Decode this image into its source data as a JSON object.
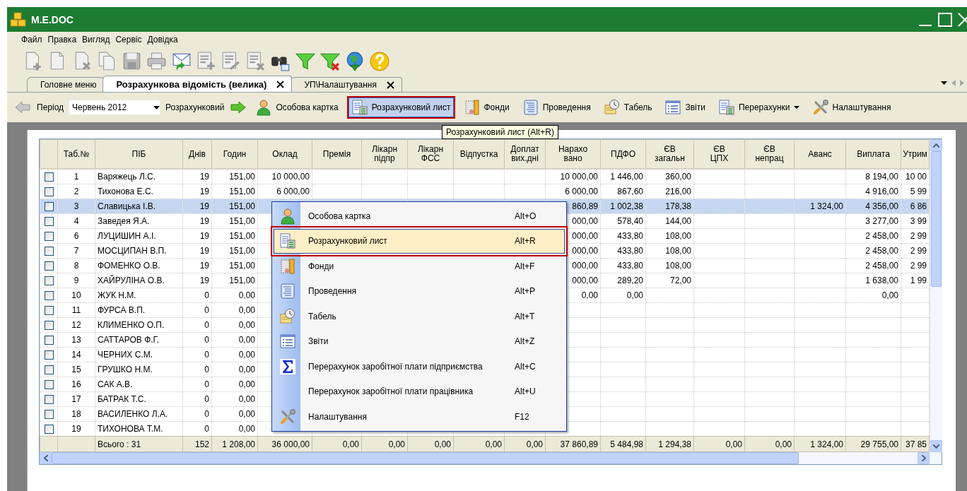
{
  "window": {
    "title": "M.E.DOC"
  },
  "menu_bar": [
    "Файл",
    "Правка",
    "Вигляд",
    "Сервіс",
    "Довідка"
  ],
  "tabs": [
    {
      "label": "Головне меню",
      "selected": false,
      "closable": false
    },
    {
      "label": "Розрахункова відомість (велика)",
      "selected": true,
      "closable": true
    },
    {
      "label": "УП\\Налаштування",
      "selected": false,
      "closable": true
    }
  ],
  "doc_toolbar": {
    "period_label": "Період",
    "period_value": "Червень 2012",
    "mode_label": "Розрахунковий",
    "buttons": [
      {
        "label": "Особова картка",
        "selected": false,
        "annotated": false,
        "dropdown": false
      },
      {
        "label": "Розрахунковий лист",
        "selected": true,
        "annotated": true,
        "dropdown": false
      },
      {
        "label": "Фонди",
        "selected": false,
        "annotated": false,
        "dropdown": false
      },
      {
        "label": "Проведення",
        "selected": false,
        "annotated": false,
        "dropdown": false
      },
      {
        "label": "Табель",
        "selected": false,
        "annotated": false,
        "dropdown": false
      },
      {
        "label": "Звіти",
        "selected": false,
        "annotated": false,
        "dropdown": false
      },
      {
        "label": "Перерахунки",
        "selected": false,
        "annotated": false,
        "dropdown": true
      },
      {
        "label": "Налаштування",
        "selected": false,
        "annotated": false,
        "dropdown": false
      }
    ]
  },
  "tooltip": "Розрахунковий лист (Alt+R)",
  "table": {
    "columns": [
      "Таб.№",
      "ПІБ",
      "Днів",
      "Годин",
      "Оклад",
      "Премія",
      "Лікарн\nпідпр",
      "Лікарн\nФСС",
      "Відпустка",
      "Доплат\nвих.дні",
      "Нарахо\nвано",
      "ПДФО",
      "ЄВ\nзагальн",
      "ЄВ\nЦПХ",
      "ЄВ\nнепрац",
      "Аванс",
      "Виплата",
      "Утрим"
    ],
    "rows": [
      {
        "checked": false,
        "selected": false,
        "cells": [
          "1",
          "Варяжець Л.С.",
          "19",
          "151,00",
          "10 000,00",
          null,
          null,
          null,
          null,
          null,
          "10 000,00",
          "1 446,00",
          "360,00",
          null,
          null,
          null,
          "8 194,00",
          "10 00"
        ]
      },
      {
        "checked": false,
        "selected": false,
        "cells": [
          "2",
          "Тихонова Е.С.",
          "19",
          "151,00",
          "6 000,00",
          null,
          null,
          null,
          null,
          null,
          "6 000,00",
          "867,60",
          "216,00",
          null,
          null,
          null,
          "4 916,00",
          "5 99"
        ]
      },
      {
        "checked": false,
        "selected": true,
        "cells": [
          "3",
          "Славицька І.В.",
          "19",
          "151,00",
          null,
          null,
          null,
          null,
          null,
          null,
          "860,89",
          "1 002,38",
          "178,38",
          null,
          null,
          "1 324,00",
          "4 356,00",
          "6 86"
        ]
      },
      {
        "checked": false,
        "selected": false,
        "cells": [
          "4",
          "Заведея Я.А.",
          "19",
          "151,00",
          null,
          null,
          null,
          null,
          null,
          null,
          "000,00",
          "578,40",
          "144,00",
          null,
          null,
          null,
          "3 277,00",
          "3 99"
        ]
      },
      {
        "checked": false,
        "selected": false,
        "cells": [
          "6",
          "ЛУЦИШИН А.І.",
          "19",
          "151,00",
          null,
          null,
          null,
          null,
          null,
          null,
          "000,00",
          "433,80",
          "108,00",
          null,
          null,
          null,
          "2 458,00",
          "2 99"
        ]
      },
      {
        "checked": false,
        "selected": false,
        "cells": [
          "7",
          "МОСЦИПАН В.П.",
          "19",
          "151,00",
          null,
          null,
          null,
          null,
          null,
          null,
          "000,00",
          "433,80",
          "108,00",
          null,
          null,
          null,
          "2 458,00",
          "2 99"
        ]
      },
      {
        "checked": false,
        "selected": false,
        "cells": [
          "8",
          "ФОМЕНКО О.В.",
          "19",
          "151,00",
          null,
          null,
          null,
          null,
          null,
          null,
          "000,00",
          "433,80",
          "108,00",
          null,
          null,
          null,
          "2 458,00",
          "2 99"
        ]
      },
      {
        "checked": false,
        "selected": false,
        "cells": [
          "9",
          "ХАЙРУЛІНА О.В.",
          "19",
          "151,00",
          null,
          null,
          null,
          null,
          null,
          null,
          "000,00",
          "289,20",
          "72,00",
          null,
          null,
          null,
          "1 638,00",
          "1 99"
        ]
      },
      {
        "checked": false,
        "selected": false,
        "cells": [
          "10",
          "ЖУК Н.М.",
          "0",
          "0,00",
          null,
          null,
          null,
          null,
          null,
          null,
          "0,00",
          "0,00",
          null,
          null,
          null,
          null,
          "0,00",
          null
        ]
      },
      {
        "checked": false,
        "selected": false,
        "cells": [
          "11",
          "ФУРСА В.П.",
          "0",
          "0,00",
          null,
          null,
          null,
          null,
          null,
          null,
          null,
          null,
          null,
          null,
          null,
          null,
          null,
          null
        ]
      },
      {
        "checked": false,
        "selected": false,
        "cells": [
          "12",
          "КЛИМЕНКО О.П.",
          "0",
          "0,00",
          null,
          null,
          null,
          null,
          null,
          null,
          null,
          null,
          null,
          null,
          null,
          null,
          null,
          null
        ]
      },
      {
        "checked": false,
        "selected": false,
        "cells": [
          "13",
          "САТТАРОВ Ф.Г.",
          "0",
          "0,00",
          null,
          null,
          null,
          null,
          null,
          null,
          null,
          null,
          null,
          null,
          null,
          null,
          null,
          null
        ]
      },
      {
        "checked": false,
        "selected": false,
        "cells": [
          "14",
          "ЧЕРНИХ С.М.",
          "0",
          "0,00",
          null,
          null,
          null,
          null,
          null,
          null,
          null,
          null,
          null,
          null,
          null,
          null,
          null,
          null
        ]
      },
      {
        "checked": false,
        "selected": false,
        "cells": [
          "15",
          "ГРУШКО Н.М.",
          "0",
          "0,00",
          null,
          null,
          null,
          null,
          null,
          null,
          null,
          null,
          null,
          null,
          null,
          null,
          null,
          null
        ]
      },
      {
        "checked": false,
        "selected": false,
        "cells": [
          "16",
          "САК А.В.",
          "0",
          "0,00",
          null,
          null,
          null,
          null,
          null,
          null,
          null,
          null,
          null,
          null,
          null,
          null,
          null,
          null
        ]
      },
      {
        "checked": false,
        "selected": false,
        "cells": [
          "17",
          "БАТРАК Т.С.",
          "0",
          "0,00",
          null,
          null,
          null,
          null,
          null,
          null,
          null,
          null,
          null,
          null,
          null,
          null,
          null,
          null
        ]
      },
      {
        "checked": false,
        "selected": false,
        "cells": [
          "18",
          "ВАСИЛЕНКО Л.А.",
          "0",
          "0,00",
          null,
          null,
          null,
          null,
          null,
          null,
          null,
          null,
          null,
          null,
          null,
          null,
          null,
          null
        ]
      },
      {
        "checked": false,
        "selected": false,
        "cells": [
          "19",
          "ТИХОНОВА Т.М.",
          "0",
          "0,00",
          null,
          null,
          null,
          null,
          null,
          null,
          null,
          null,
          null,
          null,
          null,
          null,
          null,
          null
        ]
      }
    ],
    "totals": {
      "label": "Всього : 31",
      "values": [
        "152",
        "1 208,00",
        "36 000,00",
        "0,00",
        "0,00",
        "0,00",
        "0,00",
        "0,00",
        "37 860,89",
        "5 484,98",
        "1 294,38",
        "0,00",
        "0,00",
        "1 324,00",
        "29 755,00",
        "37 85"
      ]
    }
  },
  "context_menu": {
    "items": [
      {
        "label": "Особова картка",
        "shortcut": "Alt+O",
        "selected": false,
        "annotated": false
      },
      {
        "label": "Розрахунковий лист",
        "shortcut": "Alt+R",
        "selected": true,
        "annotated": true
      },
      {
        "label": "Фонди",
        "shortcut": "Alt+F",
        "selected": false,
        "annotated": false
      },
      {
        "label": "Проведення",
        "shortcut": "Alt+P",
        "selected": false,
        "annotated": false
      },
      {
        "label": "Табель",
        "shortcut": "Alt+T",
        "selected": false,
        "annotated": false
      },
      {
        "label": "Звіти",
        "shortcut": "Alt+Z",
        "selected": false,
        "annotated": false
      },
      {
        "label": "Перерахунок заробітної плати підприємства",
        "shortcut": "Alt+C",
        "selected": false,
        "annotated": false
      },
      {
        "label": "Перерахунок заробітної плати працівника",
        "shortcut": "Alt+U",
        "selected": false,
        "annotated": false
      },
      {
        "label": "Налаштування",
        "shortcut": "F12",
        "selected": false,
        "annotated": false
      }
    ]
  }
}
